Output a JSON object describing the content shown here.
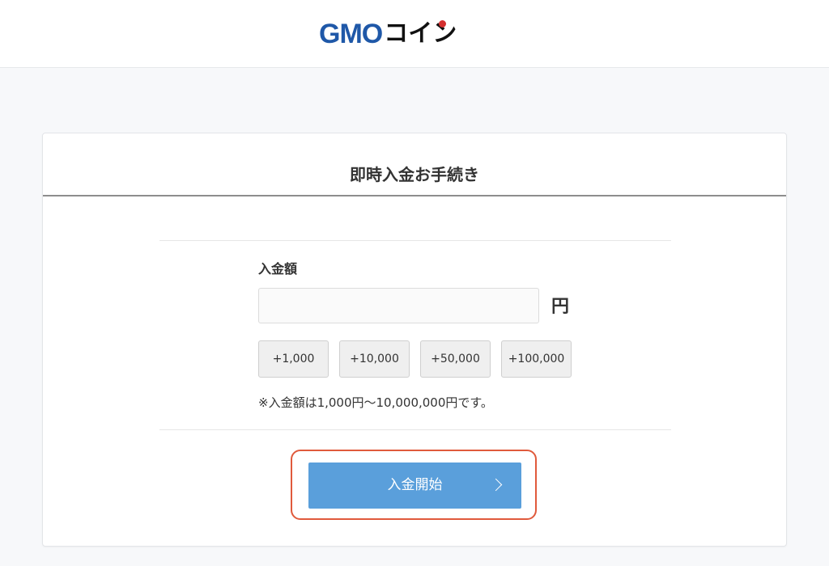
{
  "header": {
    "logo": {
      "latin": "GMO",
      "kana": "コイン",
      "brand_blue": "#1f58a8",
      "dot_red": "#d32f2f",
      "kana_color": "#111111"
    }
  },
  "card": {
    "title": "即時入金お手続き",
    "amount_label": "入金額",
    "amount_input_value": "",
    "currency_unit": "円",
    "quick_buttons": [
      "+1,000",
      "+10,000",
      "+50,000",
      "+100,000"
    ],
    "note": "※入金額は1,000円〜10,000,000円です。",
    "submit_label": "入金開始",
    "submit_icon": "chevron-right-icon"
  },
  "colors": {
    "accent": "#5a9fdb",
    "highlight": "#e05a3c",
    "background": "#f7f8fa"
  }
}
